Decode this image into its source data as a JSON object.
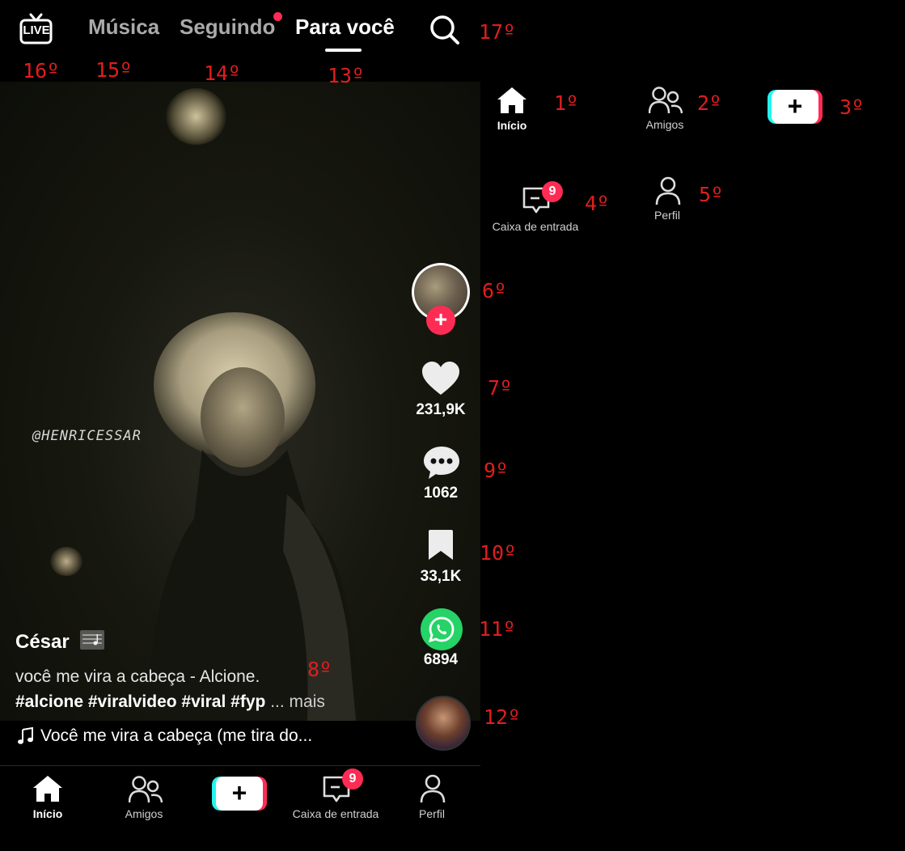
{
  "top_bar": {
    "live_label": "LIVE",
    "tabs": [
      {
        "label": "Música"
      },
      {
        "label": "Seguindo"
      },
      {
        "label": "Para você"
      }
    ],
    "search_icon": "search-icon"
  },
  "markers": {
    "m1": "1º",
    "m2": "2º",
    "m3": "3º",
    "m4": "4º",
    "m5": "5º",
    "m6": "6º",
    "m7": "7º",
    "m8": "8º",
    "m9": "9º",
    "m10": "10º",
    "m11": "11º",
    "m12": "12º",
    "m13": "13º",
    "m14": "14º",
    "m15": "15º",
    "m16": "16º",
    "m17": "17º"
  },
  "video": {
    "watermark": "@HENRICESSAR"
  },
  "actions": {
    "likes": "231,9K",
    "comments": "1062",
    "saves": "33,1K",
    "shares": "6894"
  },
  "caption": {
    "username": "César",
    "description": "você me vira a cabeça - Alcione.",
    "hashtags": "#alcione #viralvideo #viral #fyp",
    "more": "... mais",
    "sound": "Você me vira a cabeça (me tira do..."
  },
  "bottom_nav": {
    "home": "Início",
    "friends": "Amigos",
    "inbox": "Caixa de entrada",
    "inbox_badge": "9",
    "profile": "Perfil"
  },
  "colors": {
    "accent_red": "#fe2c55",
    "accent_cyan": "#25f4ee",
    "whatsapp": "#25d366",
    "marker": "#e01e1e"
  }
}
